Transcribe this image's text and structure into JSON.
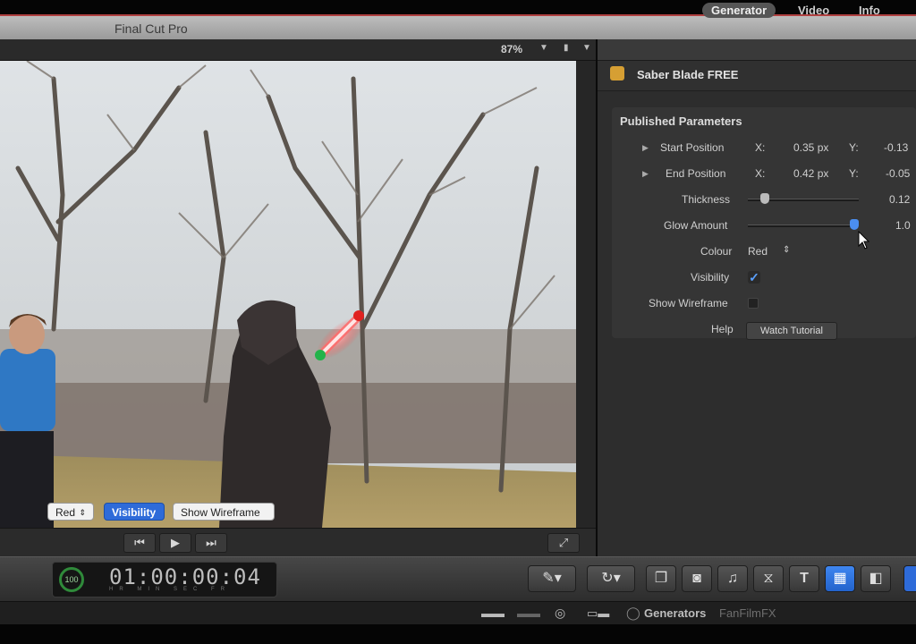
{
  "app": {
    "title": "Final Cut Pro"
  },
  "viewer": {
    "zoom": "87%",
    "controls": {
      "prev": "⏮",
      "play": "▶",
      "next": "⏭",
      "fullscreen": "⤢"
    },
    "overlay": {
      "colour": "Red",
      "visibility": "Visibility",
      "wireframe": "Show Wireframe"
    }
  },
  "inspector": {
    "tabs": [
      "Generator",
      "Video",
      "Info"
    ],
    "generator_name": "Saber Blade FREE",
    "section_title": "Published Parameters",
    "start_position": {
      "label": "Start Position",
      "x_label": "X:",
      "x": "0.35 px",
      "y_label": "Y:",
      "y": "-0.13"
    },
    "end_position": {
      "label": "End Position",
      "x_label": "X:",
      "x": "0.42 px",
      "y_label": "Y:",
      "y": "-0.05"
    },
    "thickness": {
      "label": "Thickness",
      "value": "0.12",
      "level": 0.12
    },
    "glow": {
      "label": "Glow Amount",
      "value": "1.0",
      "level": 1.0
    },
    "colour": {
      "label": "Colour",
      "value": "Red"
    },
    "visibility": {
      "label": "Visibility",
      "checked": true
    },
    "wireframe": {
      "label": "Show Wireframe",
      "checked": false
    },
    "help": {
      "label": "Help",
      "button": "Watch Tutorial"
    }
  },
  "toolbar": {
    "percent": "100",
    "timecode": "01:00:00:04",
    "units": "HR MIN SEC FR"
  },
  "browser": {
    "label": "Generators",
    "subcategory": "FanFilmFX"
  },
  "colors": {
    "accent": "#2e6bd9",
    "saber": "#ff4a4a",
    "timecode_ring": "#2f8a3a"
  },
  "icons": [
    "magic-wand-icon",
    "retime-icon",
    "clip-icon",
    "camera-icon",
    "music-icon",
    "transition-icon",
    "title-icon",
    "generator-icon",
    "theme-icon"
  ]
}
